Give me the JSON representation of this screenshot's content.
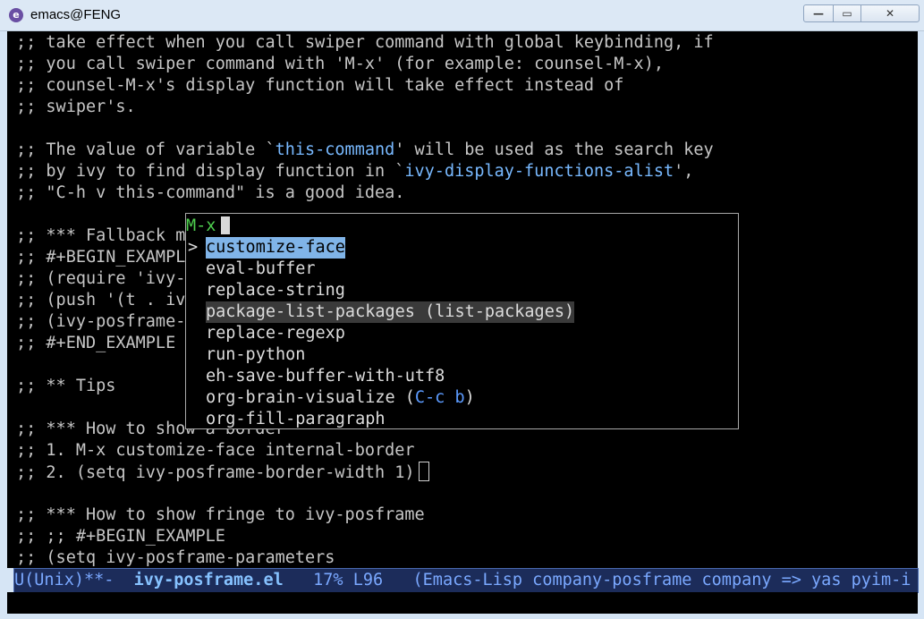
{
  "window": {
    "title": "emacs@FENG",
    "icon": "emacs-icon",
    "minimize": "—",
    "maximize": "▭",
    "close": "✕"
  },
  "editor_lines": [
    ";; take effect when you call swiper command with global keybinding, if",
    ";; you call swiper command with 'M-x' (for example: counsel-M-x),",
    ";; counsel-M-x's display function will take effect instead of",
    ";; swiper's.",
    "",
    ";; The value of variable `this-command' will be used as the search key",
    ";; by ivy to find display function in `ivy-display-functions-alist',",
    ";; \"C-h v this-command\" is a good idea.",
    "",
    ";; *** Fallback mode",
    ";; #+BEGIN_EXAMPLE",
    ";; (require 'ivy-posframe)",
    ";; (push '(t . ivy-posframe-display) ivy-display-functions-alist)",
    ";; (ivy-posframe-enable)",
    ";; #+END_EXAMPLE",
    "",
    ";; ** Tips",
    "",
    ";; *** How to show a border",
    ";; 1. M-x customize-face internal-border",
    ";; 2. (setq ivy-posframe-border-width 1)",
    "",
    ";; *** How to show fringe to ivy-posframe",
    ";; ;; #+BEGIN_EXAMPLE",
    ";; (setq ivy-posframe-parameters"
  ],
  "highlights": {
    "this_command": "this-command",
    "alist": "ivy-display-functions-alist"
  },
  "popup": {
    "prompt": "M-x",
    "arrow": ">",
    "candidates": [
      "customize-face",
      "eval-buffer",
      "replace-string",
      "package-list-packages (list-packages)",
      "replace-regexp",
      "run-python",
      "eh-save-buffer-with-utf8",
      "org-brain-visualize (",
      "org-fill-paragraph"
    ],
    "keybinding": "C-c b",
    "keybinding_close": ")",
    "selected_index": 0
  },
  "modeline": {
    "coding": "U(Unix)**-  ",
    "buffer": "ivy-posframe.el",
    "position": "   17% L96   ",
    "modes": "(Emacs-Lisp company-posframe company => yas pyim-i"
  }
}
